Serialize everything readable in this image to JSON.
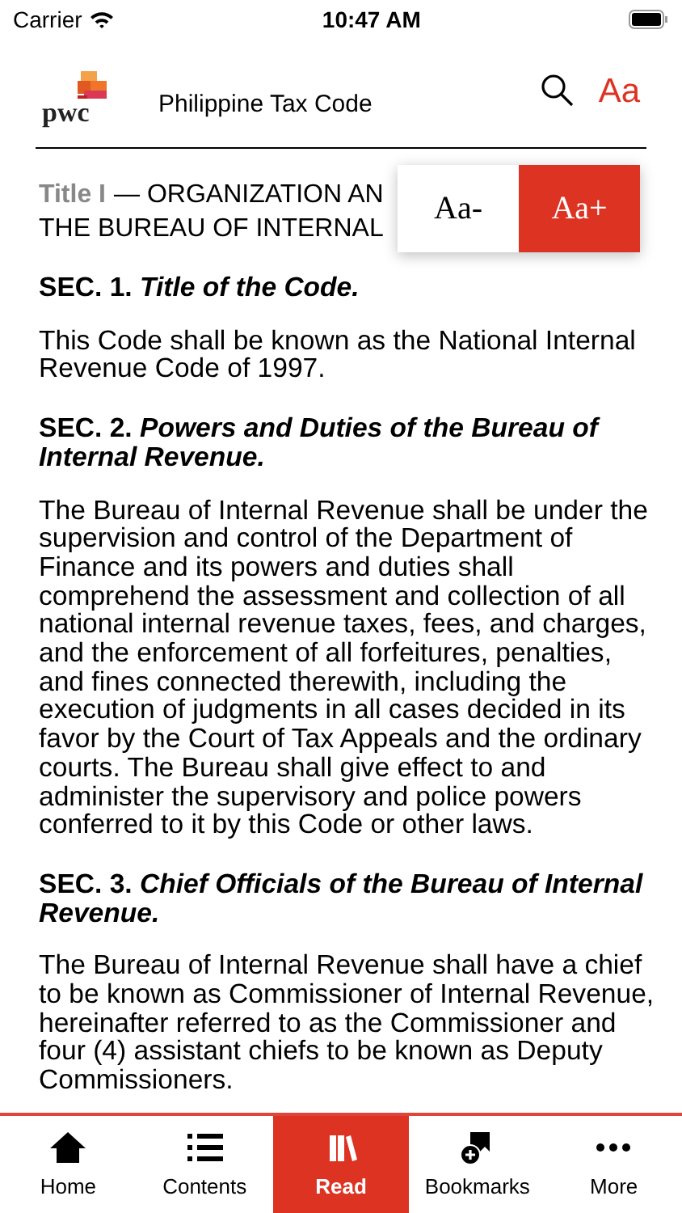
{
  "status_bar": {
    "carrier": "Carrier",
    "time": "10:47 AM"
  },
  "header": {
    "logo": "pwc",
    "title": "Philippine Tax Code",
    "font_button": "Aa"
  },
  "font_popup": {
    "buttons": [
      {
        "label": "Aa-",
        "selected": false
      },
      {
        "label": "Aa+",
        "selected": true
      }
    ]
  },
  "heading": {
    "prefix": "Title I",
    "lines": [
      "— ORGANIZATION AN",
      "THE BUREAU OF INTERNAL"
    ]
  },
  "sections": [
    {
      "number": "SEC. 1.",
      "title": "Title of the Code.",
      "body": "This Code shall be known as the National Internal Revenue Code of 1997."
    },
    {
      "number": "SEC. 2.",
      "title": "Powers and Duties of the Bureau of Internal Revenue.",
      "body": "The Bureau of Internal Revenue shall be under the supervision and control of the Department of Finance and its powers and duties shall comprehend the assessment and collection of all national internal revenue taxes, fees, and charges, and the enforcement of all forfeitures, penalties, and fines connected therewith, including the execution of judgments in all cases decided in its favor by the Court of Tax Appeals and the ordinary courts. The Bureau shall give effect to and administer the supervisory and police powers conferred to it by this Code or other laws."
    },
    {
      "number": "SEC. 3.",
      "title": "Chief Officials of the Bureau of Internal Revenue.",
      "body": "The Bureau of Internal Revenue shall have a chief to be known as Commissioner of Internal Revenue, hereinafter referred to as the Commissioner and four (4) assistant chiefs to be known as Deputy Commissioners."
    }
  ],
  "tab_bar": [
    {
      "kind": "home",
      "label": "Home",
      "selected": false
    },
    {
      "kind": "contents",
      "label": "Contents",
      "selected": false
    },
    {
      "kind": "read",
      "label": "Read",
      "selected": true
    },
    {
      "kind": "bookmarks",
      "label": "Bookmarks",
      "selected": false
    },
    {
      "kind": "more",
      "label": "More",
      "selected": false
    }
  ]
}
